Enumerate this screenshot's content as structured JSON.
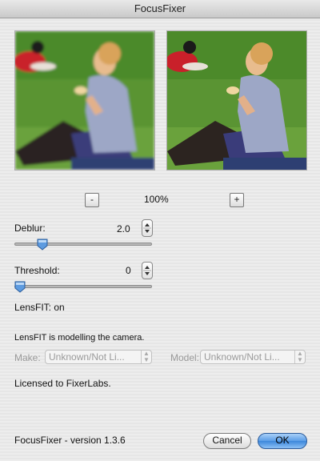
{
  "window": {
    "title": "FocusFixer"
  },
  "zoom": {
    "minus_label": "-",
    "value": "100%",
    "plus_label": "+"
  },
  "deblur": {
    "label": "Deblur:",
    "value": "2.0",
    "slider_fraction": 0.18
  },
  "threshold": {
    "label": "Threshold:",
    "value": "0",
    "slider_fraction": 0.0
  },
  "lensfit": {
    "status": "LensFIT: on",
    "modelling_text": "LensFIT is modelling the camera.",
    "make_label": "Make:",
    "make_value": "Unknown/Not Li...",
    "model_label": "Model:",
    "model_value": "Unknown/Not Li..."
  },
  "license_text": "Licensed to FixerLabs.",
  "footer": {
    "version": "FocusFixer - version 1.3.6",
    "cancel_label": "Cancel",
    "ok_label": "OK"
  },
  "colors": {
    "grass": "#4f8a2c",
    "shirt_red": "#c9202a",
    "shirt_blue": "#9da7c6",
    "ok_blue": "#3c87db"
  }
}
